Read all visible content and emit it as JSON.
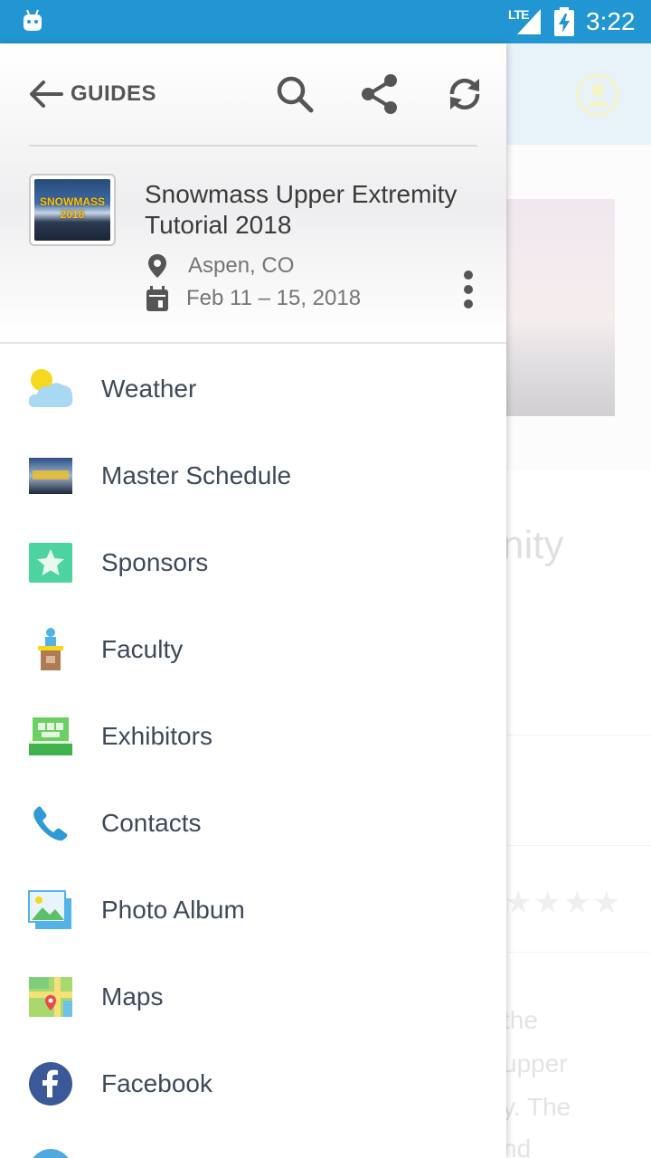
{
  "status_bar": {
    "network": "LTE",
    "time": "3:22"
  },
  "header": {
    "back_label": "GUIDES",
    "actions": [
      "search-icon",
      "share-icon",
      "refresh-icon"
    ]
  },
  "event": {
    "title": "Snowmass Upper Extremity Tutorial 2018",
    "thumbnail_text_line1": "SNOWMASS",
    "thumbnail_text_line2": "2018",
    "location": "Aspen, CO",
    "dates": "Feb 11 – 15, 2018"
  },
  "menu": {
    "items": [
      {
        "label": "Weather",
        "icon": "weather-icon"
      },
      {
        "label": "Master Schedule",
        "icon": "schedule-thumbnail-icon"
      },
      {
        "label": "Sponsors",
        "icon": "star-icon"
      },
      {
        "label": "Faculty",
        "icon": "podium-icon"
      },
      {
        "label": "Exhibitors",
        "icon": "booth-icon"
      },
      {
        "label": "Contacts",
        "icon": "phone-icon"
      },
      {
        "label": "Photo Album",
        "icon": "photo-icon"
      },
      {
        "label": "Maps",
        "icon": "map-icon"
      },
      {
        "label": "Facebook",
        "icon": "facebook-icon"
      }
    ]
  },
  "background": {
    "title_fragment": "nity",
    "desc_lines": [
      "the",
      "upper",
      "y. The",
      "nd"
    ]
  },
  "colors": {
    "status_bar": "#2196d3",
    "facebook": "#3b5998",
    "sponsors_green": "#4cd3a0"
  }
}
